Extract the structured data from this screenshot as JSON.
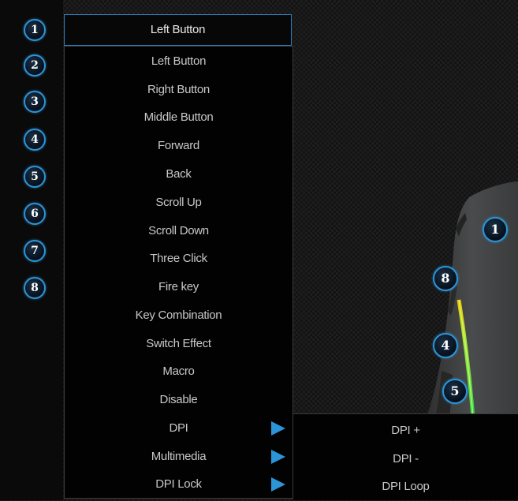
{
  "selected_function": "Left Button",
  "button_badges": [
    "1",
    "2",
    "3",
    "4",
    "5",
    "6",
    "7",
    "8"
  ],
  "menu_items": [
    {
      "label": "Left Button",
      "has_submenu": false
    },
    {
      "label": "Right Button",
      "has_submenu": false
    },
    {
      "label": "Middle Button",
      "has_submenu": false
    },
    {
      "label": "Forward",
      "has_submenu": false
    },
    {
      "label": "Back",
      "has_submenu": false
    },
    {
      "label": "Scroll Up",
      "has_submenu": false
    },
    {
      "label": "Scroll Down",
      "has_submenu": false
    },
    {
      "label": "Three Click",
      "has_submenu": false
    },
    {
      "label": "Fire key",
      "has_submenu": false
    },
    {
      "label": "Key Combination",
      "has_submenu": false
    },
    {
      "label": "Switch Effect",
      "has_submenu": false
    },
    {
      "label": "Macro",
      "has_submenu": false
    },
    {
      "label": "Disable",
      "has_submenu": false
    },
    {
      "label": "DPI",
      "has_submenu": true
    },
    {
      "label": "Multimedia",
      "has_submenu": true
    },
    {
      "label": "DPI Lock",
      "has_submenu": true
    }
  ],
  "dpi_submenu": [
    "DPI +",
    "DPI -",
    "DPI Loop"
  ],
  "mouse_badges": {
    "top": "1",
    "side_upper": "8",
    "side_middle": "4",
    "side_lower": "5"
  },
  "colors": {
    "accent": "#2b95d8",
    "text": "#c8c8c8",
    "menu_bg": "#020202"
  }
}
